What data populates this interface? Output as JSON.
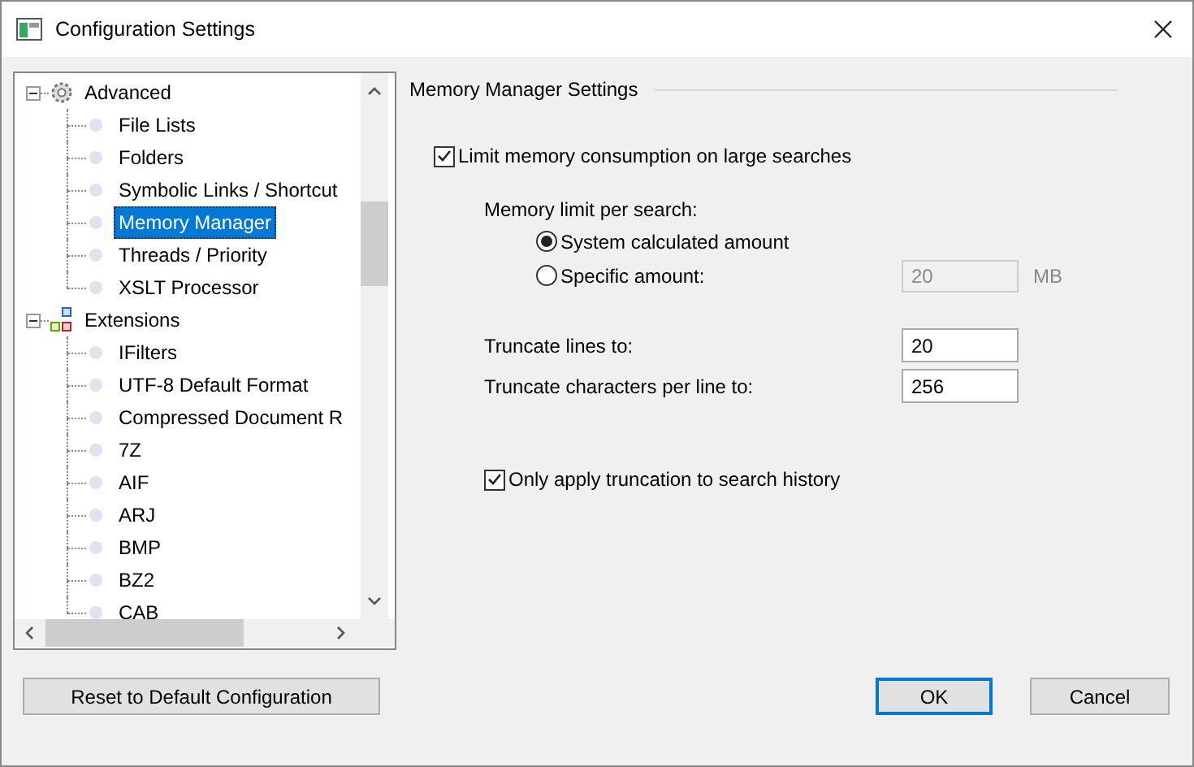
{
  "window": {
    "title": "Configuration Settings"
  },
  "tree": {
    "items": [
      {
        "label": "Advanced",
        "expanded": true,
        "selected": false,
        "children": [
          {
            "label": "File Lists",
            "selected": false
          },
          {
            "label": "Folders",
            "selected": false
          },
          {
            "label": "Symbolic Links / Shortcut",
            "selected": false
          },
          {
            "label": "Memory Manager",
            "selected": true
          },
          {
            "label": "Threads / Priority",
            "selected": false
          },
          {
            "label": "XSLT Processor",
            "selected": false
          }
        ]
      },
      {
        "label": "Extensions",
        "expanded": true,
        "selected": false,
        "children": [
          {
            "label": "IFilters",
            "selected": false
          },
          {
            "label": "UTF-8 Default Format",
            "selected": false
          },
          {
            "label": "Compressed Document R",
            "selected": false
          },
          {
            "label": "7Z",
            "selected": false
          },
          {
            "label": "AIF",
            "selected": false
          },
          {
            "label": "ARJ",
            "selected": false
          },
          {
            "label": "BMP",
            "selected": false
          },
          {
            "label": "BZ2",
            "selected": false
          },
          {
            "label": "CAB",
            "selected": false
          }
        ]
      }
    ]
  },
  "panel": {
    "title": "Memory Manager Settings",
    "limit_memory": {
      "label": "Limit memory consumption on large searches",
      "checked": true
    },
    "memory_limit_label": "Memory limit per search:",
    "options": [
      {
        "label": "System calculated amount",
        "selected": true
      },
      {
        "label": "Specific amount:",
        "selected": false
      }
    ],
    "specific_amount": {
      "value": "20",
      "disabled": true,
      "unit": "MB"
    },
    "truncate_lines": {
      "label": "Truncate lines to:",
      "value": "20"
    },
    "truncate_chars": {
      "label": "Truncate characters per line to:",
      "value": "256"
    },
    "only_history": {
      "label": "Only apply truncation to search history",
      "checked": true
    }
  },
  "buttons": {
    "reset": "Reset to Default Configuration",
    "ok": "OK",
    "cancel": "Cancel"
  }
}
